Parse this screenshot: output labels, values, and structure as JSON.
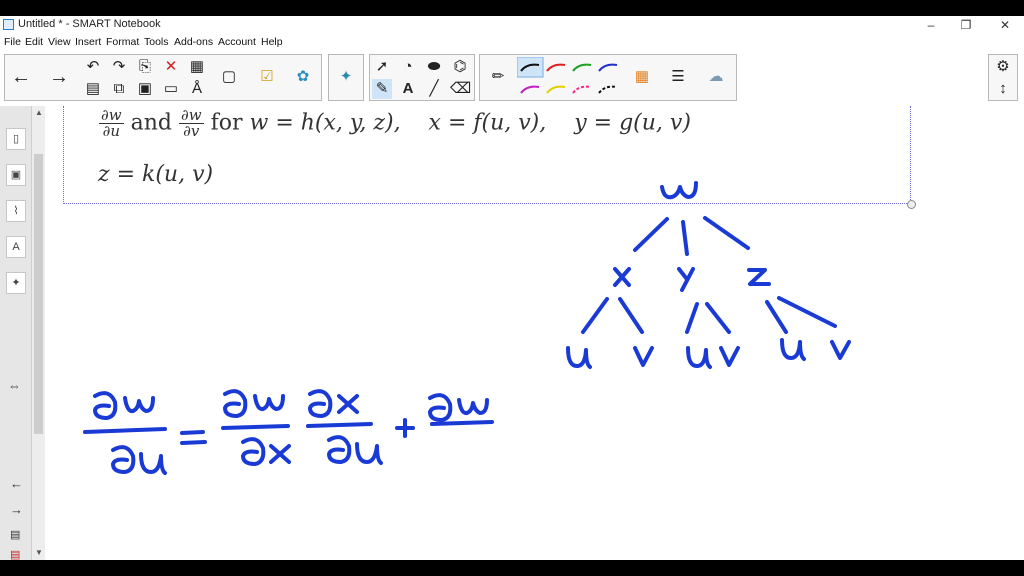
{
  "window": {
    "title": "Untitled * - SMART Notebook",
    "controls": {
      "minimize": "–",
      "restore": "❐",
      "close": "✕"
    }
  },
  "menu": [
    "File",
    "Edit",
    "View",
    "Insert",
    "Format",
    "Tools",
    "Add-ons",
    "Account",
    "Help"
  ],
  "colors": {
    "ink": "#1a3ad6",
    "pen_black": "#111111",
    "pen_red": "#e02020",
    "pen_green": "#20a020",
    "pen_blue": "#2030d0",
    "pen_magenta": "#c020c0",
    "pen_yellow": "#e0d000",
    "pen_pink": "#ff2080"
  },
  "toolbar": {
    "icons": [
      "back-arrow-icon",
      "forward-arrow-icon",
      "undo-icon",
      "redo-icon",
      "paste-icon",
      "delete-icon",
      "table-icon",
      "screen-share-icon",
      "response-icon",
      "addon-icon",
      "puzzle-icon",
      "select-icon",
      "shapes-icon",
      "eraser-icon",
      "fill-icon",
      "pen-icon",
      "text-icon",
      "line-icon",
      "magic-pen-icon",
      "pen-color-icon",
      "properties-icon",
      "settings-icon"
    ]
  },
  "math": {
    "frac1_num": "∂w",
    "frac1_den": "∂u",
    "and": "and",
    "frac2_num": "∂w",
    "frac2_den": "∂v",
    "for_text": "for",
    "w_def": "w = h(x, y, z),",
    "x_def": "x = f(u, v),",
    "y_def": "y = g(u, v)",
    "z_def": "z = k(u, v)"
  },
  "handwriting": {
    "tree_root": "w",
    "tree_level1": [
      "x",
      "y",
      "z"
    ],
    "tree_level2": [
      "u",
      "v",
      "u",
      "v",
      "u",
      "v"
    ],
    "equation": "∂w/∂u = ∂w/∂x ∂x/∂u + ∂w"
  }
}
